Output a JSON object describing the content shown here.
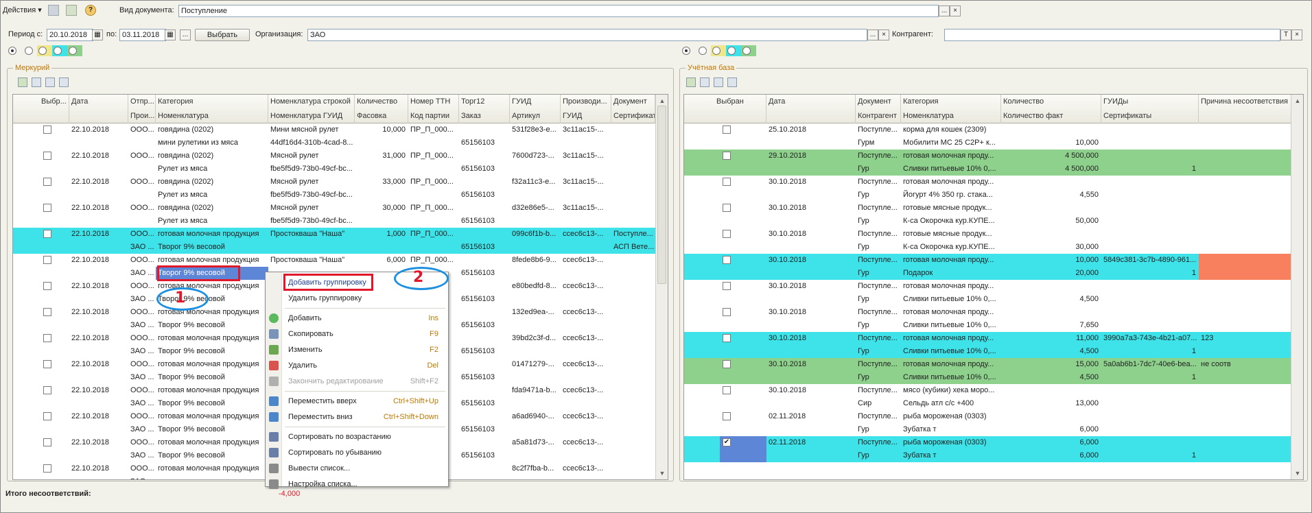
{
  "toolbar": {
    "actions_label": "Действия",
    "doc_type_label": "Вид документа:",
    "doc_type_value": "Поступление",
    "ellipsis": "...",
    "close": "×"
  },
  "filter": {
    "period_from_label": "Период с:",
    "period_from": "20.10.2018",
    "period_to_label": "по:",
    "period_to": "03.11.2018",
    "ellipsis": "...",
    "select_button": "Выбрать",
    "org_label": "Организация:",
    "org_value": "ЗАО",
    "contractor_label": "Контрагент:",
    "contractor_value": "",
    "t_button": "T",
    "close": "×"
  },
  "colors": {
    "cyan": "#3de3e8",
    "green": "#8dd18d",
    "orange": "#f9805f",
    "selected": "#5e86d6",
    "red_mark": "#e0182a",
    "callout_blue": "#1e90e0"
  },
  "left": {
    "title": "Меркурий",
    "headers": [
      [
        "Выбр...",
        ""
      ],
      [
        "Дата",
        ""
      ],
      [
        "Отпр...",
        "Прои..."
      ],
      [
        "Категория",
        "Номенклатура"
      ],
      [
        "Номенклатура строкой",
        "Номенклатура ГУИД"
      ],
      [
        "Количество",
        "Фасовка"
      ],
      [
        "Номер ТТН",
        "Код партии"
      ],
      [
        "Торг12",
        "Заказ"
      ],
      [
        "ГУИД",
        "Артикул"
      ],
      [
        "Производи...",
        "ГУИД"
      ],
      [
        "Документ",
        "Сертификат"
      ]
    ],
    "rows": [
      {
        "style": "",
        "checked": false,
        "date": "22.10.2018",
        "a1": "ООО...",
        "a2": "",
        "cat": "говядина (0202)",
        "nom": "мини рулетики из мяса",
        "str": "Мини мясной рулет",
        "guid_n": "44df16d4-310b-4cad-8...",
        "qty": "10,000",
        "pack": "",
        "ttn": "ПР_П_000...",
        "lot": "",
        "torg": "",
        "order": "65156103",
        "guid": "531f28e3-e...",
        "art": "",
        "prod": "3c11ac15-...",
        "doc": "",
        "cert": ""
      },
      {
        "style": "",
        "checked": false,
        "date": "22.10.2018",
        "a1": "ООО...",
        "a2": "",
        "cat": "говядина (0202)",
        "nom": "Рулет из мяса",
        "str": "Мясной рулет",
        "guid_n": "fbe5f5d9-73b0-49cf-bc...",
        "qty": "31,000",
        "pack": "",
        "ttn": "ПР_П_000...",
        "lot": "",
        "torg": "",
        "order": "65156103",
        "guid": "7600d723-...",
        "art": "",
        "prod": "3c11ac15-...",
        "doc": "",
        "cert": ""
      },
      {
        "style": "",
        "checked": false,
        "date": "22.10.2018",
        "a1": "ООО...",
        "a2": "",
        "cat": "говядина (0202)",
        "nom": "Рулет из мяса",
        "str": "Мясной рулет",
        "guid_n": "fbe5f5d9-73b0-49cf-bc...",
        "qty": "33,000",
        "pack": "",
        "ttn": "ПР_П_000...",
        "lot": "",
        "torg": "",
        "order": "65156103",
        "guid": "f32a11c3-e...",
        "art": "",
        "prod": "3c11ac15-...",
        "doc": "",
        "cert": ""
      },
      {
        "style": "",
        "checked": false,
        "date": "22.10.2018",
        "a1": "ООО...",
        "a2": "",
        "cat": "говядина (0202)",
        "nom": "Рулет из мяса",
        "str": "Мясной рулет",
        "guid_n": "fbe5f5d9-73b0-49cf-bc...",
        "qty": "30,000",
        "pack": "",
        "ttn": "ПР_П_000...",
        "lot": "",
        "torg": "",
        "order": "65156103",
        "guid": "d32e86e5-...",
        "art": "",
        "prod": "3c11ac15-...",
        "doc": "",
        "cert": ""
      },
      {
        "style": "cyan",
        "checked": false,
        "date": "22.10.2018",
        "a1": "ООО...",
        "a2": "ЗАО ...",
        "cat": "готовая молочная продукция",
        "nom": "Творог 9% весовой",
        "str": "Простокваша \"Наша\"",
        "guid_n": "",
        "qty": "1,000",
        "pack": "",
        "ttn": "ПР_П_000...",
        "lot": "",
        "torg": "",
        "order": "65156103",
        "guid": "099c6f1b-b...",
        "art": "",
        "prod": "ccec6c13-...",
        "doc": "Поступле...",
        "cert": "АСП Вете..."
      },
      {
        "style": "",
        "checked": false,
        "date": "22.10.2018",
        "a1": "ООО...",
        "a2": "ЗАО ...",
        "cat": "готовая молочная продукция",
        "nom": "Творог 9% весовой",
        "str": "Простокваша \"Наша\"",
        "guid_n": "",
        "qty": "6,000",
        "pack": "",
        "ttn": "ПР_П_000...",
        "lot": "",
        "torg": "",
        "order": "65156103",
        "guid": "8fede8b6-9...",
        "art": "",
        "prod": "ccec6c13-...",
        "doc": "",
        "cert": ""
      },
      {
        "style": "",
        "checked": false,
        "date": "22.10.2018",
        "a1": "ООО...",
        "a2": "ЗАО ...",
        "cat": "готовая молочная продукция",
        "nom": "Творог 9% весовой",
        "str": "",
        "guid_n": "",
        "qty": "",
        "pack": "",
        "ttn": "",
        "lot": "",
        "torg": "",
        "order": "65156103",
        "guid": "e80bedfd-8...",
        "art": "",
        "prod": "ccec6c13-...",
        "doc": "",
        "cert": ""
      },
      {
        "style": "",
        "checked": false,
        "date": "22.10.2018",
        "a1": "ООО...",
        "a2": "ЗАО ...",
        "cat": "готовая молочная продукция",
        "nom": "Творог 9% весовой",
        "str": "",
        "guid_n": "",
        "qty": "",
        "pack": "",
        "ttn": "",
        "lot": "",
        "torg": "",
        "order": "65156103",
        "guid": "132ed9ea-...",
        "art": "",
        "prod": "ccec6c13-...",
        "doc": "",
        "cert": ""
      },
      {
        "style": "",
        "checked": false,
        "date": "22.10.2018",
        "a1": "ООО...",
        "a2": "ЗАО ...",
        "cat": "готовая молочная продукция",
        "nom": "Творог 9% весовой",
        "str": "",
        "guid_n": "",
        "qty": "",
        "pack": "",
        "ttn": "",
        "lot": "",
        "torg": "",
        "order": "65156103",
        "guid": "39bd2c3f-d...",
        "art": "",
        "prod": "ccec6c13-...",
        "doc": "",
        "cert": ""
      },
      {
        "style": "",
        "checked": false,
        "date": "22.10.2018",
        "a1": "ООО...",
        "a2": "ЗАО ...",
        "cat": "готовая молочная продукция",
        "nom": "Творог 9% весовой",
        "str": "",
        "guid_n": "",
        "qty": "",
        "pack": "",
        "ttn": "",
        "lot": "",
        "torg": "",
        "order": "65156103",
        "guid": "01471279-...",
        "art": "",
        "prod": "ccec6c13-...",
        "doc": "",
        "cert": ""
      },
      {
        "style": "",
        "checked": false,
        "date": "22.10.2018",
        "a1": "ООО...",
        "a2": "ЗАО ...",
        "cat": "готовая молочная продукция",
        "nom": "Творог 9% весовой",
        "str": "",
        "guid_n": "",
        "qty": "",
        "pack": "",
        "ttn": "",
        "lot": "",
        "torg": "",
        "order": "65156103",
        "guid": "fda9471a-b...",
        "art": "",
        "prod": "ccec6c13-...",
        "doc": "",
        "cert": ""
      },
      {
        "style": "",
        "checked": false,
        "date": "22.10.2018",
        "a1": "ООО...",
        "a2": "ЗАО ...",
        "cat": "готовая молочная продукция",
        "nom": "Творог 9% весовой",
        "str": "",
        "guid_n": "",
        "qty": "",
        "pack": "",
        "ttn": "",
        "lot": "",
        "torg": "",
        "order": "65156103",
        "guid": "a6ad6940-...",
        "art": "",
        "prod": "ccec6c13-...",
        "doc": "",
        "cert": ""
      },
      {
        "style": "",
        "checked": false,
        "date": "22.10.2018",
        "a1": "ООО...",
        "a2": "ЗАО ...",
        "cat": "готовая молочная продукция",
        "nom": "Творог 9% весовой",
        "str": "",
        "guid_n": "",
        "qty": "",
        "pack": "",
        "ttn": "",
        "lot": "",
        "torg": "",
        "order": "65156103",
        "guid": "a5a81d73-...",
        "art": "",
        "prod": "ccec6c13-...",
        "doc": "",
        "cert": ""
      },
      {
        "style": "",
        "checked": false,
        "date": "22.10.2018",
        "a1": "ООО...",
        "a2": "ЗАО ...",
        "cat": "готовая молочная продукция",
        "nom": "",
        "str": "",
        "guid_n": "",
        "qty": "",
        "pack": "",
        "ttn": "",
        "lot": "",
        "torg": "",
        "order": "",
        "guid": "8c2f7fba-b...",
        "art": "",
        "prod": "ccec6c13-...",
        "doc": "",
        "cert": ""
      }
    ]
  },
  "right": {
    "title": "Учётная база",
    "headers": [
      [
        "Выбран",
        ""
      ],
      [
        "Дата",
        ""
      ],
      [
        "Документ",
        "Контрагент"
      ],
      [
        "Категория",
        "Номенклатура"
      ],
      [
        "Количество",
        "Количество факт"
      ],
      [
        "ГУИДы",
        "Сертификаты"
      ],
      [
        "Причина несоответствия",
        ""
      ]
    ],
    "rows": [
      {
        "style": "",
        "checked": false,
        "date": "25.10.2018",
        "doc": "Поступле...",
        "ctr": "Гурм",
        "cat": "корма для кошек (2309)",
        "nom": "Мобилити МС 25 С2Р+ к...",
        "qty": "",
        "qf": "10,000",
        "guid": "",
        "cert": "",
        "reason": ""
      },
      {
        "style": "green",
        "checked": false,
        "date": "29.10.2018",
        "doc": "Поступле...",
        "ctr": "Гур",
        "cat": "готовая молочная проду...",
        "nom": "Сливки питьевые 10% 0,...",
        "qty": "4 500,000",
        "qf": "4 500,000",
        "guid": "",
        "cert": "1",
        "reason": ""
      },
      {
        "style": "",
        "checked": false,
        "date": "30.10.2018",
        "doc": "Поступле...",
        "ctr": "Гур",
        "cat": "готовая молочная проду...",
        "nom": "Йогурт  4% 350 гр. стака...",
        "qty": "",
        "qf": "4,550",
        "guid": "",
        "cert": "",
        "reason": ""
      },
      {
        "style": "",
        "checked": false,
        "date": "30.10.2018",
        "doc": "Поступле...",
        "ctr": "Гур",
        "cat": "готовые мясные продук...",
        "nom": "К-са Окорочка кур.КУПЕ...",
        "qty": "",
        "qf": "50,000",
        "guid": "",
        "cert": "",
        "reason": ""
      },
      {
        "style": "",
        "checked": false,
        "date": "30.10.2018",
        "doc": "Поступле...",
        "ctr": "Гур",
        "cat": "готовые мясные продук...",
        "nom": "К-са Окорочка кур.КУПЕ...",
        "qty": "",
        "qf": "30,000",
        "guid": "",
        "cert": "",
        "reason": ""
      },
      {
        "style": "cyan",
        "checked": false,
        "date": "30.10.2018",
        "doc": "Поступле...",
        "ctr": "Гур",
        "cat": "готовая молочная проду...",
        "nom": "Подарок",
        "qty": "10,000",
        "qf": "20,000",
        "guid": "5849c381-3c7b-4890-961...",
        "cert": "1",
        "reason": "",
        "reason_orange": true
      },
      {
        "style": "",
        "checked": false,
        "date": "30.10.2018",
        "doc": "Поступле...",
        "ctr": "Гур",
        "cat": "готовая молочная проду...",
        "nom": "Сливки питьевые 10% 0,...",
        "qty": "",
        "qf": "4,500",
        "guid": "",
        "cert": "",
        "reason": ""
      },
      {
        "style": "",
        "checked": false,
        "date": "30.10.2018",
        "doc": "Поступле...",
        "ctr": "Гур",
        "cat": "готовая молочная проду...",
        "nom": "Сливки питьевые 10% 0,...",
        "qty": "",
        "qf": "7,650",
        "guid": "",
        "cert": "",
        "reason": ""
      },
      {
        "style": "cyan",
        "checked": false,
        "date": "30.10.2018",
        "doc": "Поступле...",
        "ctr": "Гур",
        "cat": "готовая молочная проду...",
        "nom": "Сливки питьевые 10% 0,...",
        "qty": "11,000",
        "qf": "4,500",
        "guid": "3990a7a3-743e-4b21-a07...",
        "cert": "1",
        "reason": "123"
      },
      {
        "style": "green",
        "checked": false,
        "date": "30.10.2018",
        "doc": "Поступле...",
        "ctr": "Гур",
        "cat": "готовая молочная проду...",
        "nom": "Сливки питьевые 10% 0,...",
        "qty": "15,000",
        "qf": "4,500",
        "guid": "5a0ab6b1-7dc7-40e6-bea...",
        "cert": "1",
        "reason": "не соотв"
      },
      {
        "style": "",
        "checked": false,
        "date": "30.10.2018",
        "doc": "Поступле...",
        "ctr": "Сир",
        "cat": "мясо (кубики) хека моро...",
        "nom": "Сельдь атл с/с +400",
        "qty": "",
        "qf": "13,000",
        "guid": "",
        "cert": "",
        "reason": ""
      },
      {
        "style": "",
        "checked": false,
        "date": "02.11.2018",
        "doc": "Поступле...",
        "ctr": "Гур",
        "cat": "рыба мороженая (0303)",
        "nom": "Зубатка т",
        "qty": "",
        "qf": "6,000",
        "guid": "",
        "cert": "",
        "reason": ""
      },
      {
        "style": "cyan",
        "checked": true,
        "date": "02.11.2018",
        "doc": "Поступле...",
        "ctr": "Гур",
        "cat": "рыба мороженая (0303)",
        "nom": "Зубатка т",
        "qty": "6,000",
        "qf": "6,000",
        "guid": "",
        "cert": "1",
        "reason": ""
      }
    ]
  },
  "selected_cell": "Творог 9% весовой",
  "context_menu": [
    {
      "label": "Добавить группировку",
      "key": "",
      "icon": "",
      "highlight": true
    },
    {
      "label": "Удалить группировку",
      "key": "",
      "icon": ""
    },
    {
      "sep": true
    },
    {
      "label": "Добавить",
      "key": "Ins",
      "icon": "add-icon"
    },
    {
      "label": "Скопировать",
      "key": "F9",
      "icon": "copy-icon"
    },
    {
      "label": "Изменить",
      "key": "F2",
      "icon": "edit-icon"
    },
    {
      "label": "Удалить",
      "key": "Del",
      "icon": "delete-icon"
    },
    {
      "label": "Закончить редактирование",
      "key": "Shift+F2",
      "icon": "end-edit-icon",
      "disabled": true
    },
    {
      "sep": true
    },
    {
      "label": "Переместить вверх",
      "key": "Ctrl+Shift+Up",
      "icon": "move-up-icon"
    },
    {
      "label": "Переместить вниз",
      "key": "Ctrl+Shift+Down",
      "icon": "move-down-icon"
    },
    {
      "sep": true
    },
    {
      "label": "Сортировать по возрастанию",
      "key": "",
      "icon": "sort-asc-icon"
    },
    {
      "label": "Сортировать по убыванию",
      "key": "",
      "icon": "sort-desc-icon"
    },
    {
      "label": "Вывести список...",
      "key": "",
      "icon": "print-list-icon"
    },
    {
      "label": "Настройка списка...",
      "key": "",
      "icon": "list-settings-icon"
    }
  ],
  "callouts": [
    "1",
    "2"
  ],
  "footer": {
    "label": "Итого несоответствий:",
    "value": "-4,000"
  }
}
